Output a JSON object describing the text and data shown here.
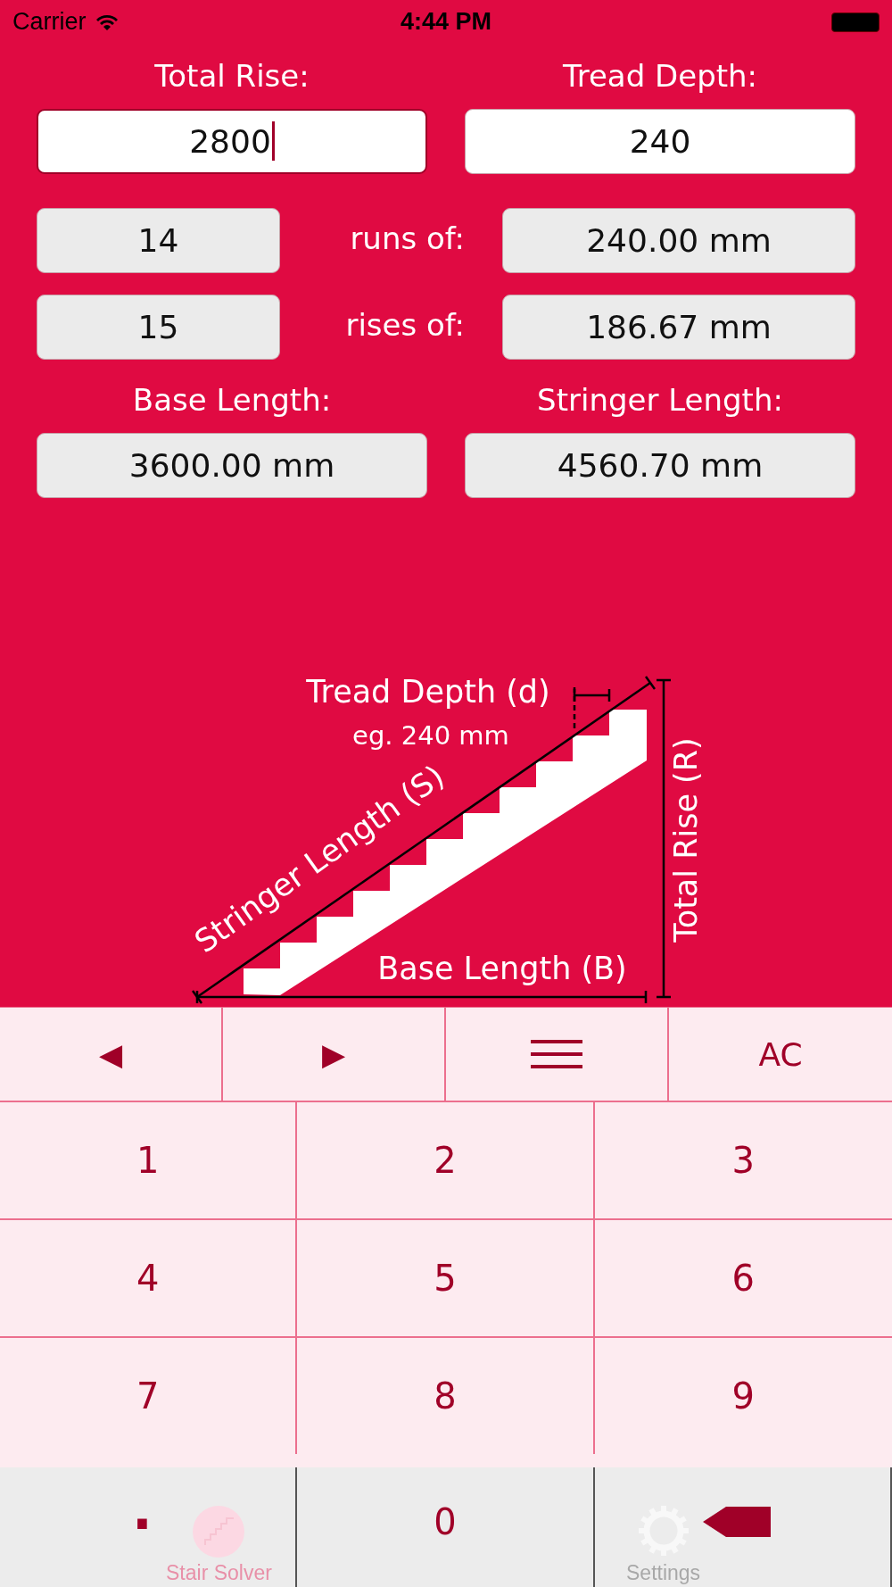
{
  "status_bar": {
    "carrier": "Carrier",
    "time": "4:44 PM"
  },
  "inputs": [
    {
      "label": "Total Rise:",
      "value": "2800",
      "focused": true
    },
    {
      "label": "Tread Depth:",
      "value": "240",
      "focused": false
    }
  ],
  "counts": [
    {
      "count": "14",
      "label": "runs of:",
      "result": "240.00 mm"
    },
    {
      "count": "15",
      "label": "rises of:",
      "result": "186.67 mm"
    }
  ],
  "lengths": [
    {
      "label": "Base Length:",
      "value": "3600.00 mm"
    },
    {
      "label": "Stringer Length:",
      "value": "4560.70 mm"
    }
  ],
  "diagram": {
    "tread_label": "Tread Depth (d)",
    "tread_example": "eg. 240 mm",
    "stringer_label": "Stringer Length (S)",
    "base_label": "Base Length (B)",
    "rise_label": "Total Rise (R)"
  },
  "keypad": {
    "top_row": [
      {
        "kind": "text",
        "label": "◀"
      },
      {
        "kind": "text",
        "label": "▶"
      },
      {
        "kind": "menu"
      },
      {
        "kind": "text",
        "label": "AC"
      }
    ],
    "keys": [
      {
        "kind": "text",
        "label": "1"
      },
      {
        "kind": "text",
        "label": "2"
      },
      {
        "kind": "text",
        "label": "3"
      },
      {
        "kind": "text",
        "label": "4"
      },
      {
        "kind": "text",
        "label": "5"
      },
      {
        "kind": "text",
        "label": "6"
      },
      {
        "kind": "text",
        "label": "7"
      },
      {
        "kind": "text",
        "label": "8"
      },
      {
        "kind": "text",
        "label": "9"
      },
      {
        "kind": "dot",
        "label": "."
      },
      {
        "kind": "text",
        "label": "0"
      },
      {
        "kind": "backspace"
      }
    ]
  },
  "tab_bar": [
    {
      "kind": "stairs",
      "label": "Stair Solver",
      "selected": true
    },
    {
      "kind": "gear",
      "label": "Settings",
      "selected": false
    }
  ]
}
